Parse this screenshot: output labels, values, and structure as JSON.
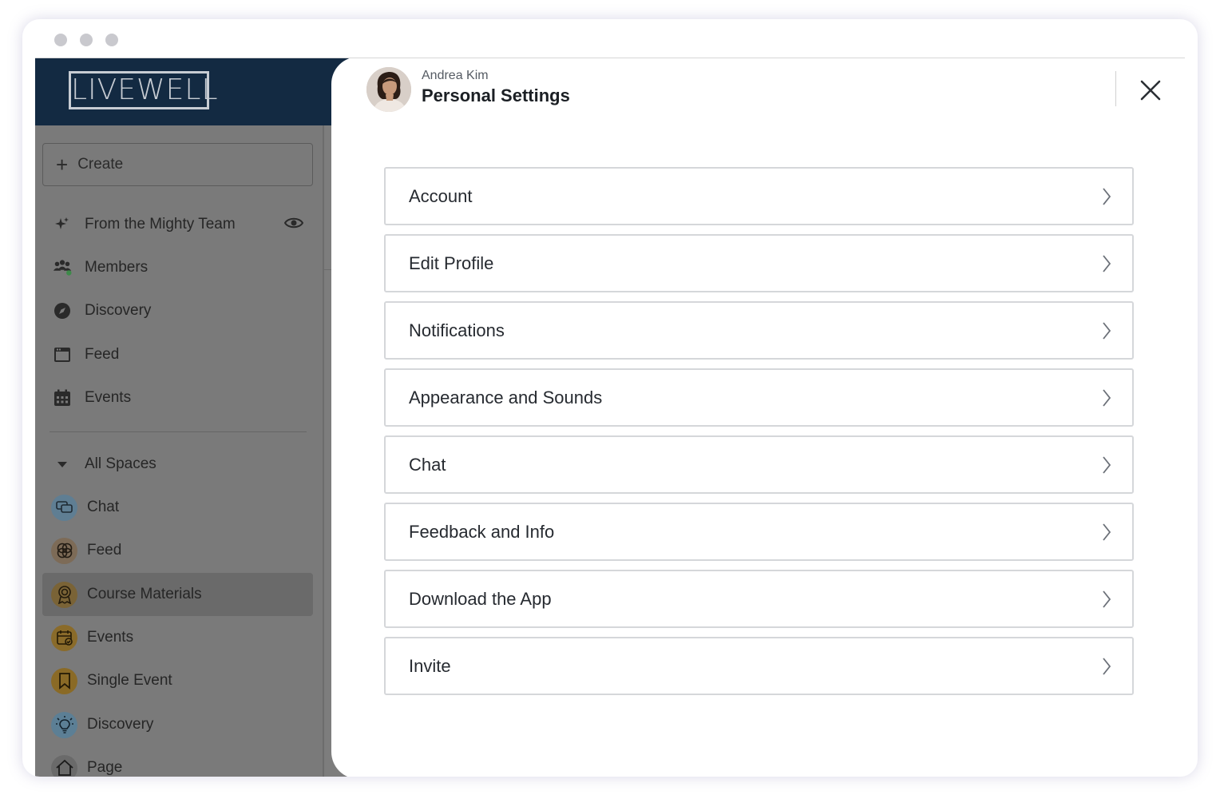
{
  "brand": {
    "logo_text": "LIVEWELL"
  },
  "sidebar": {
    "create_label": "Create",
    "items": [
      {
        "label": "From the Mighty Team",
        "icon": "sparkle-icon"
      },
      {
        "label": "Members",
        "icon": "members-icon"
      },
      {
        "label": "Discovery",
        "icon": "compass-icon"
      },
      {
        "label": "Feed",
        "icon": "feed-icon"
      },
      {
        "label": "Events",
        "icon": "calendar-icon"
      }
    ],
    "spaces_header": "All Spaces",
    "spaces": [
      {
        "label": "Chat",
        "icon": "chat-bubbles-icon",
        "color": "#5f7e93"
      },
      {
        "label": "Feed",
        "icon": "venn-icon",
        "color": "#7d6b57"
      },
      {
        "label": "Course Materials",
        "icon": "award-icon",
        "color": "#7a6336",
        "selected": true
      },
      {
        "label": "Events",
        "icon": "calendar-check-icon",
        "color": "#8a6b2a"
      },
      {
        "label": "Single Event",
        "icon": "bookmark-icon",
        "color": "#8a6a26"
      },
      {
        "label": "Discovery",
        "icon": "lightbulb-icon",
        "color": "#5c7f95"
      },
      {
        "label": "Page",
        "icon": "home-icon",
        "color": "#6a6a6a"
      }
    ]
  },
  "settings": {
    "user_name": "Andrea Kim",
    "title": "Personal Settings",
    "menu": [
      {
        "label": "Account"
      },
      {
        "label": "Edit Profile"
      },
      {
        "label": "Notifications"
      },
      {
        "label": "Appearance and Sounds"
      },
      {
        "label": "Chat"
      },
      {
        "label": "Feedback and Info"
      },
      {
        "label": "Download the App"
      },
      {
        "label": "Invite"
      }
    ]
  },
  "colors": {
    "header_navy": "#132a42",
    "overlay_gray": "#7a7a7a",
    "panel_bg": "#ffffff"
  }
}
